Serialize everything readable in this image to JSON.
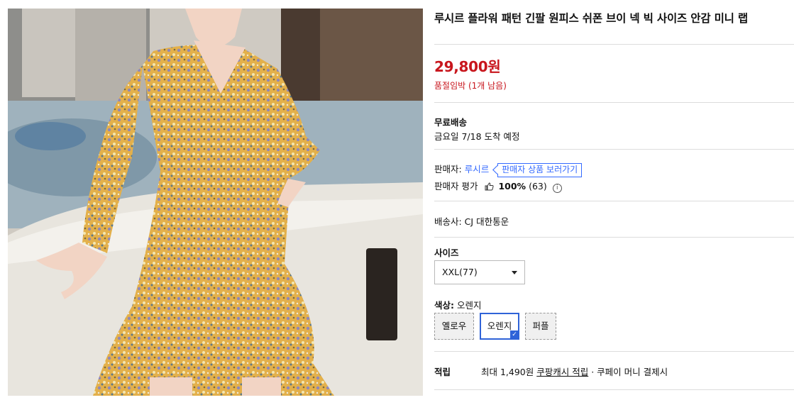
{
  "product": {
    "title": "루시르 플라워 패턴 긴팔 원피스 쉬폰 브이 넥 빅 사이즈 안감 미니 랩",
    "price": "29,800원",
    "stock_notice": "품절임박 (1개 남음)"
  },
  "shipping": {
    "type": "무료배송",
    "arrival": "금요일 7/18 도착 예정"
  },
  "seller": {
    "label": "판매자:",
    "name": "루시르",
    "view_button": "판매자 상품 보러가기",
    "rating_label": "판매자 평가",
    "rating_percent": "100%",
    "rating_count": "(63)"
  },
  "courier": {
    "text": "배송사:  CJ 대한통운"
  },
  "size": {
    "label": "사이즈",
    "selected": "XXL(77)"
  },
  "color": {
    "label_prefix": "색상:",
    "label_value": "오렌지",
    "options": [
      "옐로우",
      "오렌지",
      "퍼플"
    ],
    "selected_index": 1,
    "accent": "#2f63d8"
  },
  "reward": {
    "label": "적립",
    "max_text": "최대 1,490원",
    "link_text": "쿠팡캐시 적립",
    "suffix": "· 쿠페이 머니 결제시"
  },
  "colors": {
    "price_red": "#c8161d",
    "seller_blue": "#346aff"
  },
  "icons": [
    "thumbs-up-icon",
    "info-icon",
    "chevron-down-icon",
    "check-icon"
  ]
}
